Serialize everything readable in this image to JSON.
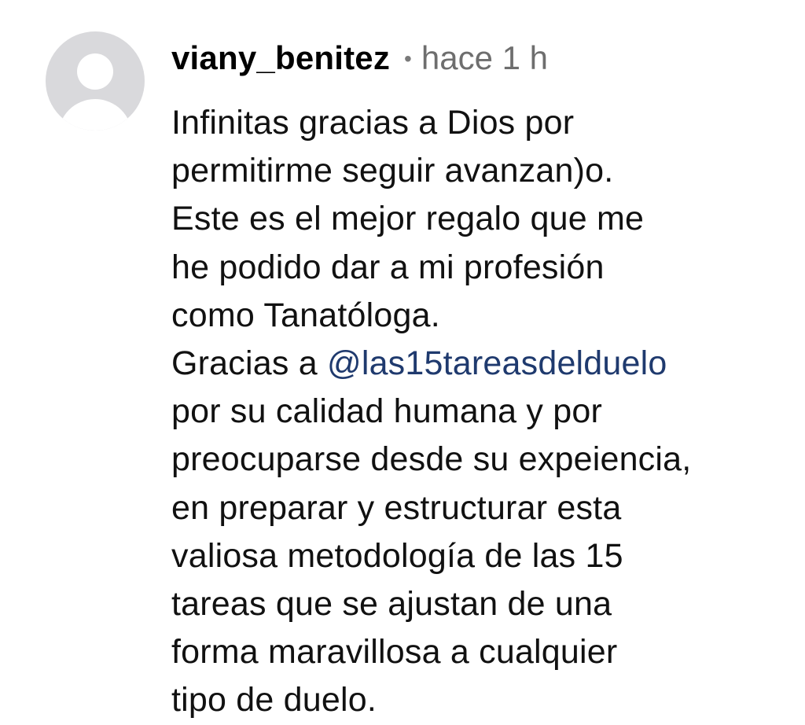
{
  "comment": {
    "username": "viany_benitez",
    "separator": "•",
    "time": "hace 1 h",
    "lines": [
      "Infinitas gracias a Dios por",
      "permitirme seguir avanzan)o.",
      "Este es el mejor regalo que me",
      "he podido dar a mi profesión",
      "como Tanatóloga."
    ],
    "mention_prefix": "Gracias a ",
    "mention": "@las15tareasdelduelo",
    "lines_after": [
      "por su calidad humana y por",
      "preocuparse desde su expeiencia,",
      "en preparar y estructurar esta",
      "valiosa metodología de las 15",
      "tareas que se ajustan de una",
      "forma maravillosa a cualquier",
      "tipo de duelo."
    ]
  },
  "colors": {
    "mention": "#1f3a6e",
    "avatar_bg": "#d9d9dc",
    "time": "#6e6e6e"
  },
  "icons": {
    "avatar": "default-user-avatar-icon"
  }
}
